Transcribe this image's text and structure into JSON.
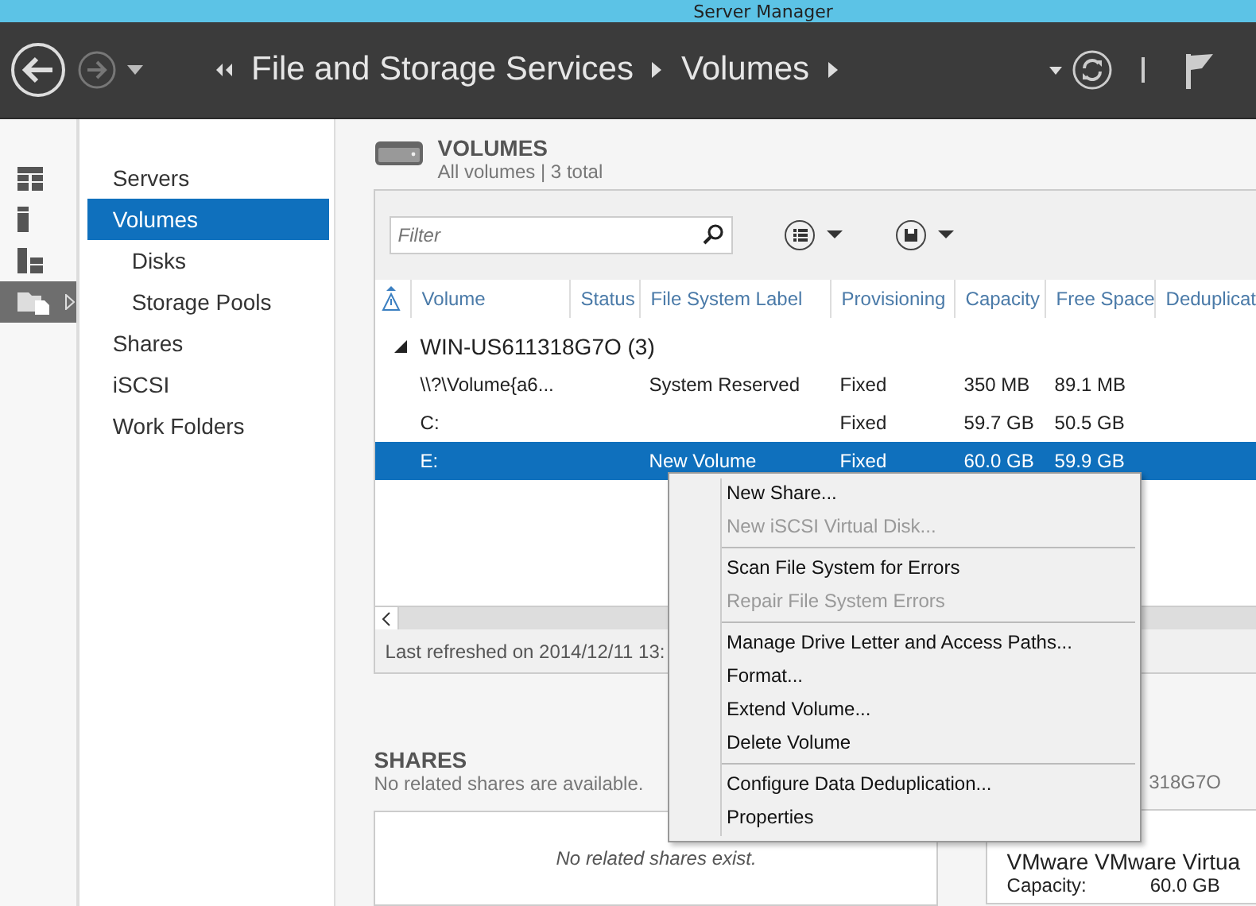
{
  "window": {
    "title": "Server Manager"
  },
  "header": {
    "breadcrumb": [
      "File and Storage Services",
      "Volumes"
    ]
  },
  "rail": [
    {
      "selected": false
    },
    {
      "selected": false
    },
    {
      "selected": false
    },
    {
      "selected": true
    }
  ],
  "nav": [
    {
      "label": "Servers",
      "selected": false
    },
    {
      "label": "Volumes",
      "selected": true,
      "children": [
        {
          "label": "Disks",
          "selected": false
        },
        {
          "label": "Storage Pools",
          "selected": false
        }
      ]
    },
    {
      "label": "Shares",
      "selected": false
    },
    {
      "label": "iSCSI",
      "selected": false
    },
    {
      "label": "Work Folders",
      "selected": false
    }
  ],
  "volumes": {
    "title": "VOLUMES",
    "subtitle": "All volumes | 3 total",
    "filter": {
      "placeholder": "Filter"
    },
    "columns": [
      "Volume",
      "Status",
      "File System Label",
      "Provisioning",
      "Capacity",
      "Free Space",
      "Deduplicat"
    ],
    "group": {
      "label": "WIN-US611318G7O (3)",
      "expanded": true
    },
    "rows": [
      {
        "cells": [
          "\\\\?\\Volume{a6...",
          "",
          "System Reserved",
          "Fixed",
          "350 MB",
          "89.1 MB",
          ""
        ],
        "selected": false
      },
      {
        "cells": [
          "C:",
          "",
          "",
          "Fixed",
          "59.7 GB",
          "50.5 GB",
          ""
        ],
        "selected": false
      },
      {
        "cells": [
          "E:",
          "",
          "New Volume",
          "Fixed",
          "60.0 GB",
          "59.9 GB",
          ""
        ],
        "selected": true
      }
    ],
    "footer": "Last refreshed on 2014/12/11 13:"
  },
  "context_menu": [
    {
      "label": "New Share...",
      "disabled": false,
      "separator_before": false
    },
    {
      "label": "New iSCSI Virtual Disk...",
      "disabled": true,
      "separator_before": false
    },
    {
      "label": "Scan File System for Errors",
      "disabled": false,
      "separator_before": true
    },
    {
      "label": "Repair File System Errors",
      "disabled": true,
      "separator_before": false
    },
    {
      "label": "Manage Drive Letter and Access Paths...",
      "disabled": false,
      "separator_before": true
    },
    {
      "label": "Format...",
      "disabled": false,
      "separator_before": false
    },
    {
      "label": "Extend Volume...",
      "disabled": false,
      "separator_before": false
    },
    {
      "label": "Delete Volume",
      "disabled": false,
      "separator_before": false
    },
    {
      "label": "Configure Data Deduplication...",
      "disabled": false,
      "separator_before": true
    },
    {
      "label": "Properties",
      "disabled": false,
      "separator_before": false
    }
  ],
  "shares": {
    "title": "SHARES",
    "subtitle": "No related shares are available.",
    "empty": "No related shares exist."
  },
  "disk": {
    "subtitle": "318G7O",
    "name": "VMware VMware Virtua",
    "capacity_label": "Capacity:",
    "capacity": "60.0 GB"
  }
}
